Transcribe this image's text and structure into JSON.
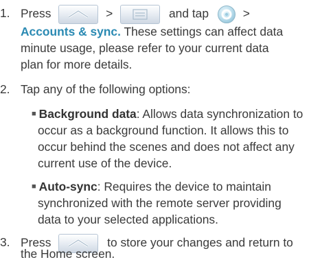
{
  "steps": [
    {
      "number": "1.",
      "line1": {
        "press": "Press",
        "sep1": ">",
        "and_tap": "and tap",
        "sep2": ">"
      },
      "link": "Accounts & sync.",
      "line2_rest": "These settings can affect data",
      "line3": "minute usage, please refer to your current data",
      "line4": "plan for more details.",
      "icons": [
        "home-icon",
        "menu-icon",
        "settings-icon"
      ]
    },
    {
      "number": "2.",
      "text": "Tap any of the following options:",
      "options": [
        {
          "label": "Background data",
          "line1": ": Allows data synchronization to",
          "line2": "occur as a background function. It allows this to",
          "line3": "occur behind the scenes and does not affect any",
          "line4": "current use of the device."
        },
        {
          "label": "Auto-sync",
          "line1": ": Requires the device to maintain",
          "line2": "synchronized with the remote server providing",
          "line3": "data to your selected applications."
        }
      ]
    },
    {
      "number": "3.",
      "press": "Press",
      "line1_rest": "to store your changes and return to",
      "line2": "the Home screen.",
      "icons": [
        "home-icon"
      ]
    }
  ],
  "colors": {
    "text": "#3a3a3a",
    "link": "#2b8ab3",
    "button_border": "#b5c4d4"
  }
}
